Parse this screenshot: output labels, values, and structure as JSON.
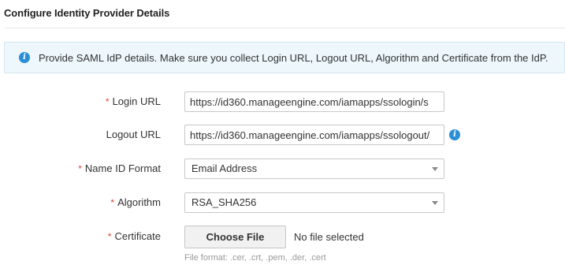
{
  "section": {
    "title": "Configure Identity Provider Details"
  },
  "info_banner": {
    "icon": "info-icon",
    "text": "Provide SAML IdP details. Make sure you collect Login URL, Logout URL, Algorithm and Certificate from the IdP."
  },
  "form": {
    "required_marker": "*",
    "login_url": {
      "label": "Login URL",
      "required": true,
      "value": "https://id360.manageengine.com/iamapps/ssologin/s"
    },
    "logout_url": {
      "label": "Logout URL",
      "required": false,
      "value": "https://id360.manageengine.com/iamapps/ssologout/",
      "help_icon": "info-icon"
    },
    "name_id_format": {
      "label": "Name ID Format",
      "required": true,
      "selected": "Email Address"
    },
    "algorithm": {
      "label": "Algorithm",
      "required": true,
      "selected": "RSA_SHA256"
    },
    "certificate": {
      "label": "Certificate",
      "required": true,
      "button_label": "Choose File",
      "status": "No file selected",
      "hint": "File format: .cer, .crt, .pem, .der, .cert"
    }
  },
  "colors": {
    "accent_blue": "#2b8fd6",
    "required_red": "#e0462f",
    "info_bg": "#eef7fc"
  }
}
